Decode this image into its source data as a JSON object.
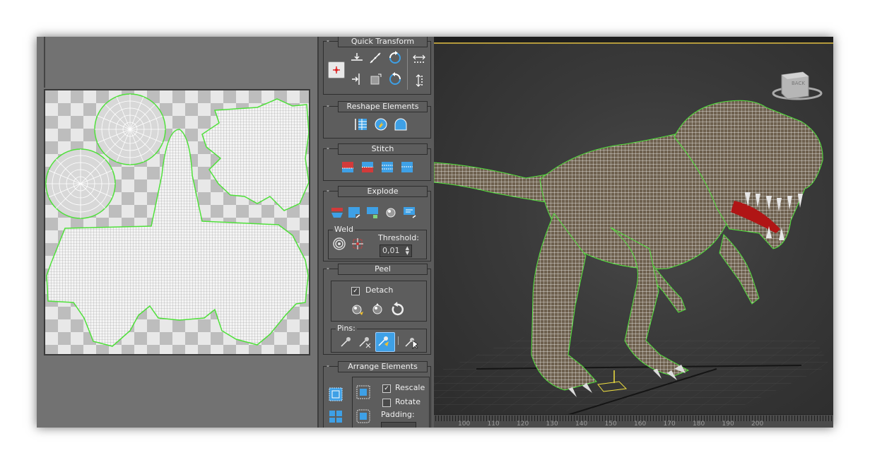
{
  "panel": {
    "quick_transform": {
      "title": "Quick Transform"
    },
    "reshape": {
      "title": "Reshape Elements"
    },
    "stitch": {
      "title": "Stitch"
    },
    "explode": {
      "title": "Explode",
      "weld_label": "Weld",
      "threshold_label": "Threshold:",
      "threshold_value": "0,01"
    },
    "peel": {
      "title": "Peel",
      "detach_label": "Detach",
      "detach_checked": true,
      "pins_label": "Pins:"
    },
    "arrange": {
      "title": "Arrange Elements",
      "rescale_label": "Rescale",
      "rescale_checked": true,
      "rotate_label": "Rotate",
      "rotate_checked": false,
      "padding_label": "Padding:"
    }
  },
  "viewcube": {
    "face_label": "BACK"
  },
  "timeline": {
    "ticks": [
      "100",
      "110",
      "120",
      "130",
      "140",
      "150",
      "160",
      "170",
      "180",
      "190",
      "200"
    ]
  },
  "colors": {
    "accent_blue": "#3ea0e6",
    "seam_green": "#4fe03a",
    "active_frame": "#b49a3c"
  }
}
